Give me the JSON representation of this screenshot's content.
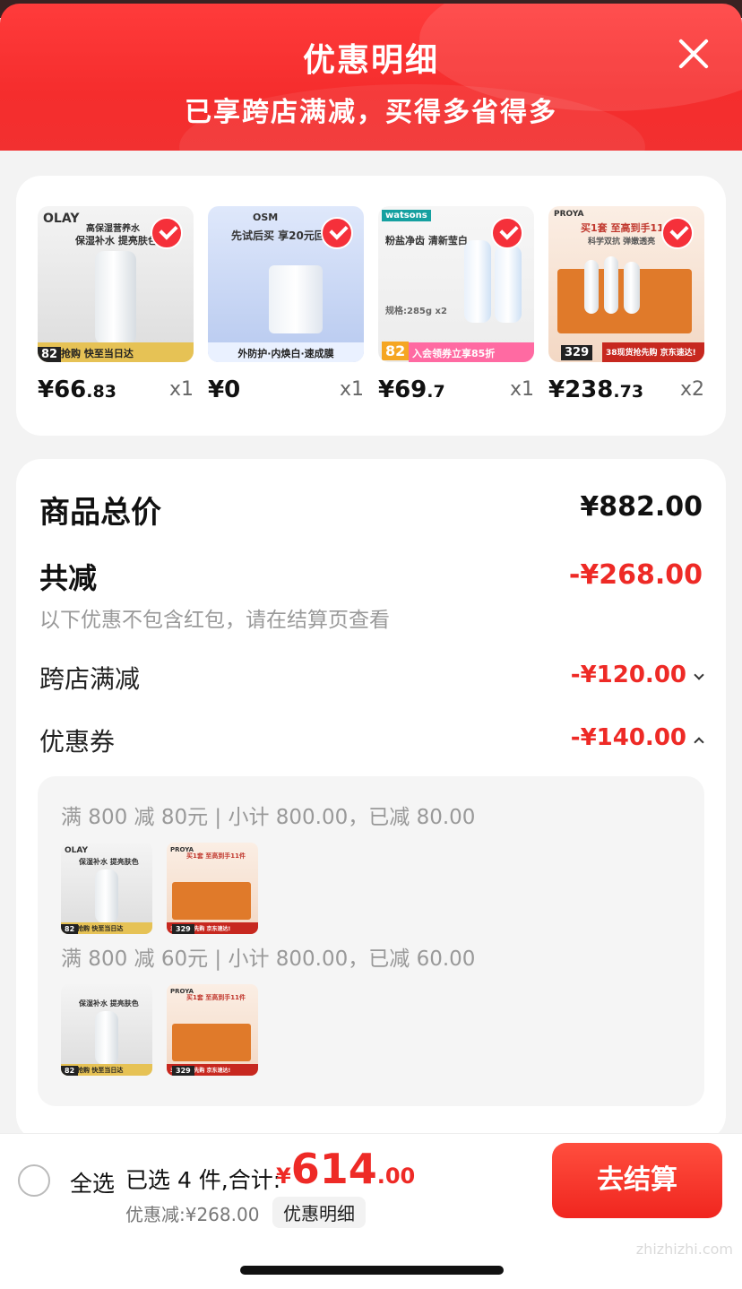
{
  "header": {
    "title": "优惠明细",
    "subtitle": "已享跨店满减，买得多省得多"
  },
  "products": [
    {
      "name": "olay-product",
      "img_text": "高保湿营养水",
      "img_text2": "保湿补水 提亮肤色",
      "strip": "立即抢购 快至当日达",
      "badge": "82",
      "price_int": "¥66",
      "price_dec": ".83",
      "qty": "x1"
    },
    {
      "name": "osm-product",
      "img_text": "先试后买 享20元回购",
      "img_text2": "外防护·内焕白·速成膜",
      "strip": "",
      "badge": "",
      "price_int": "¥0",
      "price_dec": "",
      "qty": "x1"
    },
    {
      "name": "watsons-product",
      "img_text": "粉盐净齿 清新莹白",
      "img_text2": "规格:285g x2",
      "strip": "入会领券立享85折",
      "badge": "82",
      "price_int": "¥69",
      "price_dec": ".7",
      "qty": "x1"
    },
    {
      "name": "proya-product",
      "img_text": "买1套 至高到手11件",
      "img_text2": "科学双抗 弹嫩透亮",
      "strip": "38现货抢先购 京东速达!",
      "badge": "329",
      "price_int": "¥238",
      "price_dec": ".73",
      "qty": "x2"
    }
  ],
  "brands": {
    "olay": "OLAY",
    "osm": "OSM",
    "watsons": "watsons",
    "proya": "PROYA"
  },
  "summary": {
    "total_label": "商品总价",
    "total_value": "¥882.00",
    "reduce_label": "共减",
    "reduce_value": "-¥268.00",
    "reduce_note": "以下优惠不包含红包，请在结算页查看",
    "cross_store_label": "跨店满减",
    "cross_store_value": "-¥120.00",
    "coupon_label": "优惠券",
    "coupon_value": "-¥140.00"
  },
  "coupons": [
    {
      "text": "满 800 减 80元 | 小计 800.00，已减 80.00"
    },
    {
      "text": "满 800 减 60元 | 小计 800.00，已减 60.00"
    }
  ],
  "mini_badges": {
    "olay": "82",
    "proya": "329"
  },
  "bottom": {
    "select_all": "全选",
    "selected_count": "已选 4 件,合计:",
    "currency": "¥",
    "total_int": "614",
    "total_dec": ".00",
    "discount_note": "优惠减:¥268.00",
    "detail_chip": "优惠明细",
    "checkout": "去结算"
  },
  "watermark": "zhizhizhi.com",
  "colors": {
    "accent": "#ee2a26",
    "header_red": "#f52d2d",
    "check_red": "#f5303a"
  }
}
